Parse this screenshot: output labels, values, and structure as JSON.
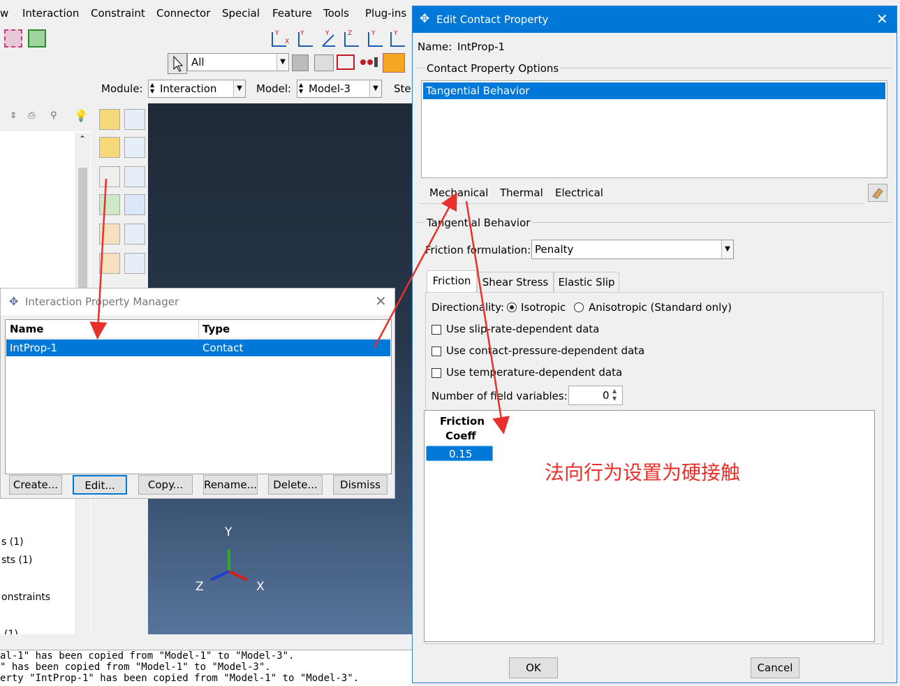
{
  "menu": {
    "items": [
      "w",
      "Interaction",
      "Constraint",
      "Connector",
      "Special",
      "Feature",
      "Tools",
      "Plug-ins"
    ]
  },
  "toolbar": {
    "selection_filter": "All",
    "module_label": "Module:",
    "module_value": "Interaction",
    "model_label": "Model:",
    "model_value": "Model-3",
    "step_label": "Ste"
  },
  "tree": {
    "items": [
      "s (1)",
      "sts (1)",
      "onstraints",
      "(1)"
    ]
  },
  "messages": [
    "al-1\" has been copied from \"Model-1\" to \"Model-3\".",
    "\" has been copied from \"Model-1\" to \"Model-3\".",
    "erty \"IntProp-1\" has been copied from \"Model-1\" to \"Model-3\"."
  ],
  "triad": {
    "y": "Y",
    "z": "Z",
    "x": "X"
  },
  "manager": {
    "title": "Interaction Property Manager",
    "columns": [
      "Name",
      "Type"
    ],
    "rows": [
      {
        "name": "IntProp-1",
        "type": "Contact"
      }
    ],
    "buttons": [
      "Create...",
      "Edit...",
      "Copy...",
      "Rename...",
      "Delete...",
      "Dismiss"
    ]
  },
  "edit": {
    "title": "Edit Contact Property",
    "name_label": "Name:",
    "name_value": "IntProp-1",
    "options_group": "Contact Property Options",
    "options": [
      "Tangential Behavior"
    ],
    "menus": [
      "Mechanical",
      "Thermal",
      "Electrical"
    ],
    "section_title": "Tangential Behavior",
    "friction_label": "Friction formulation:",
    "friction_value": "Penalty",
    "tabs": [
      "Friction",
      "Shear Stress",
      "Elastic Slip"
    ],
    "directionality_label": "Directionality:",
    "isotropic": "Isotropic",
    "anisotropic": "Anisotropic (Standard only)",
    "checks": [
      "Use slip-rate-dependent data",
      "Use contact-pressure-dependent data",
      "Use temperature-dependent data"
    ],
    "field_vars_label": "Number of field variables:",
    "field_vars_value": "0",
    "table_header_1": "Friction",
    "table_header_2": "Coeff",
    "table_value": "0.15",
    "ok": "OK",
    "cancel": "Cancel"
  },
  "annotation": {
    "text": "法向行为设置为硬接触",
    "color": "#e8312a"
  },
  "colors": {
    "accent": "#0078d7",
    "arrow": "#e8312a"
  }
}
